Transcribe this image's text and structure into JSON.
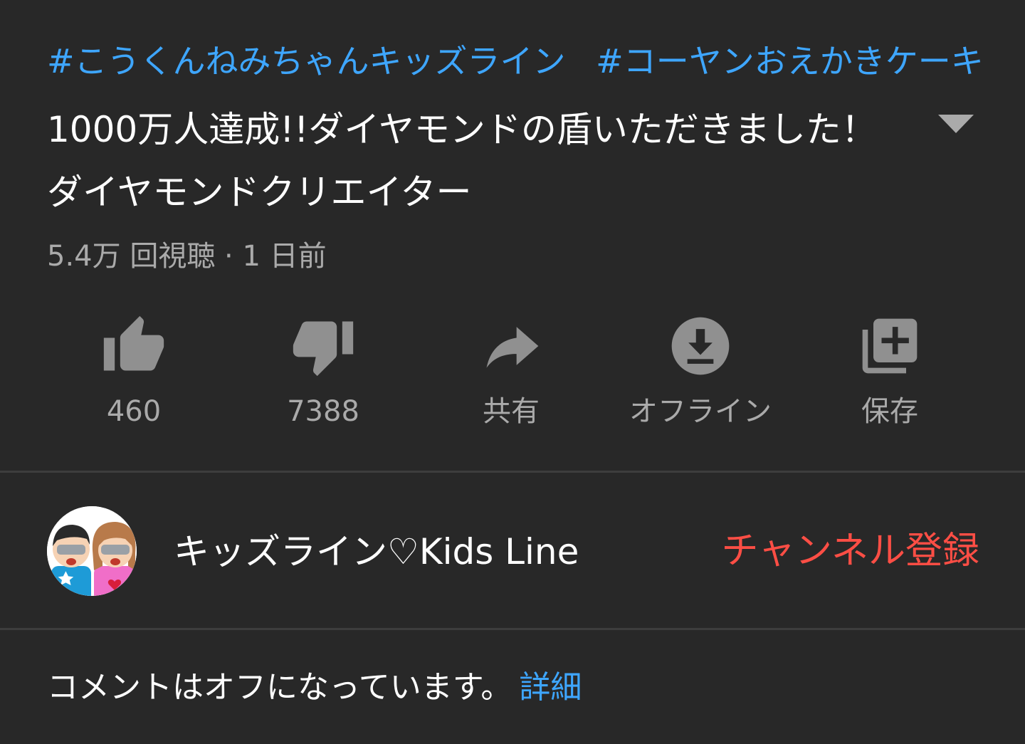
{
  "hashtags": [
    "#こうくんねみちゃんキッズライン",
    "#コーヤンおえかきケーキ"
  ],
  "video": {
    "title": "1000万人達成!!ダイヤモンドの盾いただきました！ダイヤモンドクリエイター",
    "meta": "5.4万 回視聴 · 1 日前"
  },
  "actions": [
    {
      "label": "460",
      "icon": "thumb-up-icon"
    },
    {
      "label": "7388",
      "icon": "thumb-down-icon"
    },
    {
      "label": "共有",
      "icon": "share-icon"
    },
    {
      "label": "オフライン",
      "icon": "download-icon"
    },
    {
      "label": "保存",
      "icon": "playlist-add-icon"
    }
  ],
  "channel": {
    "name": "キッズライン♡Kids Line",
    "subscribe_label": "チャンネル登録"
  },
  "comments": {
    "status": "コメントはオフになっています。",
    "details_link": "詳細"
  },
  "colors": {
    "background": "#282828",
    "link": "#3ea6ff",
    "subscribe": "#ff4e45",
    "secondary_text": "#aaaaaa",
    "icon": "#909090"
  }
}
